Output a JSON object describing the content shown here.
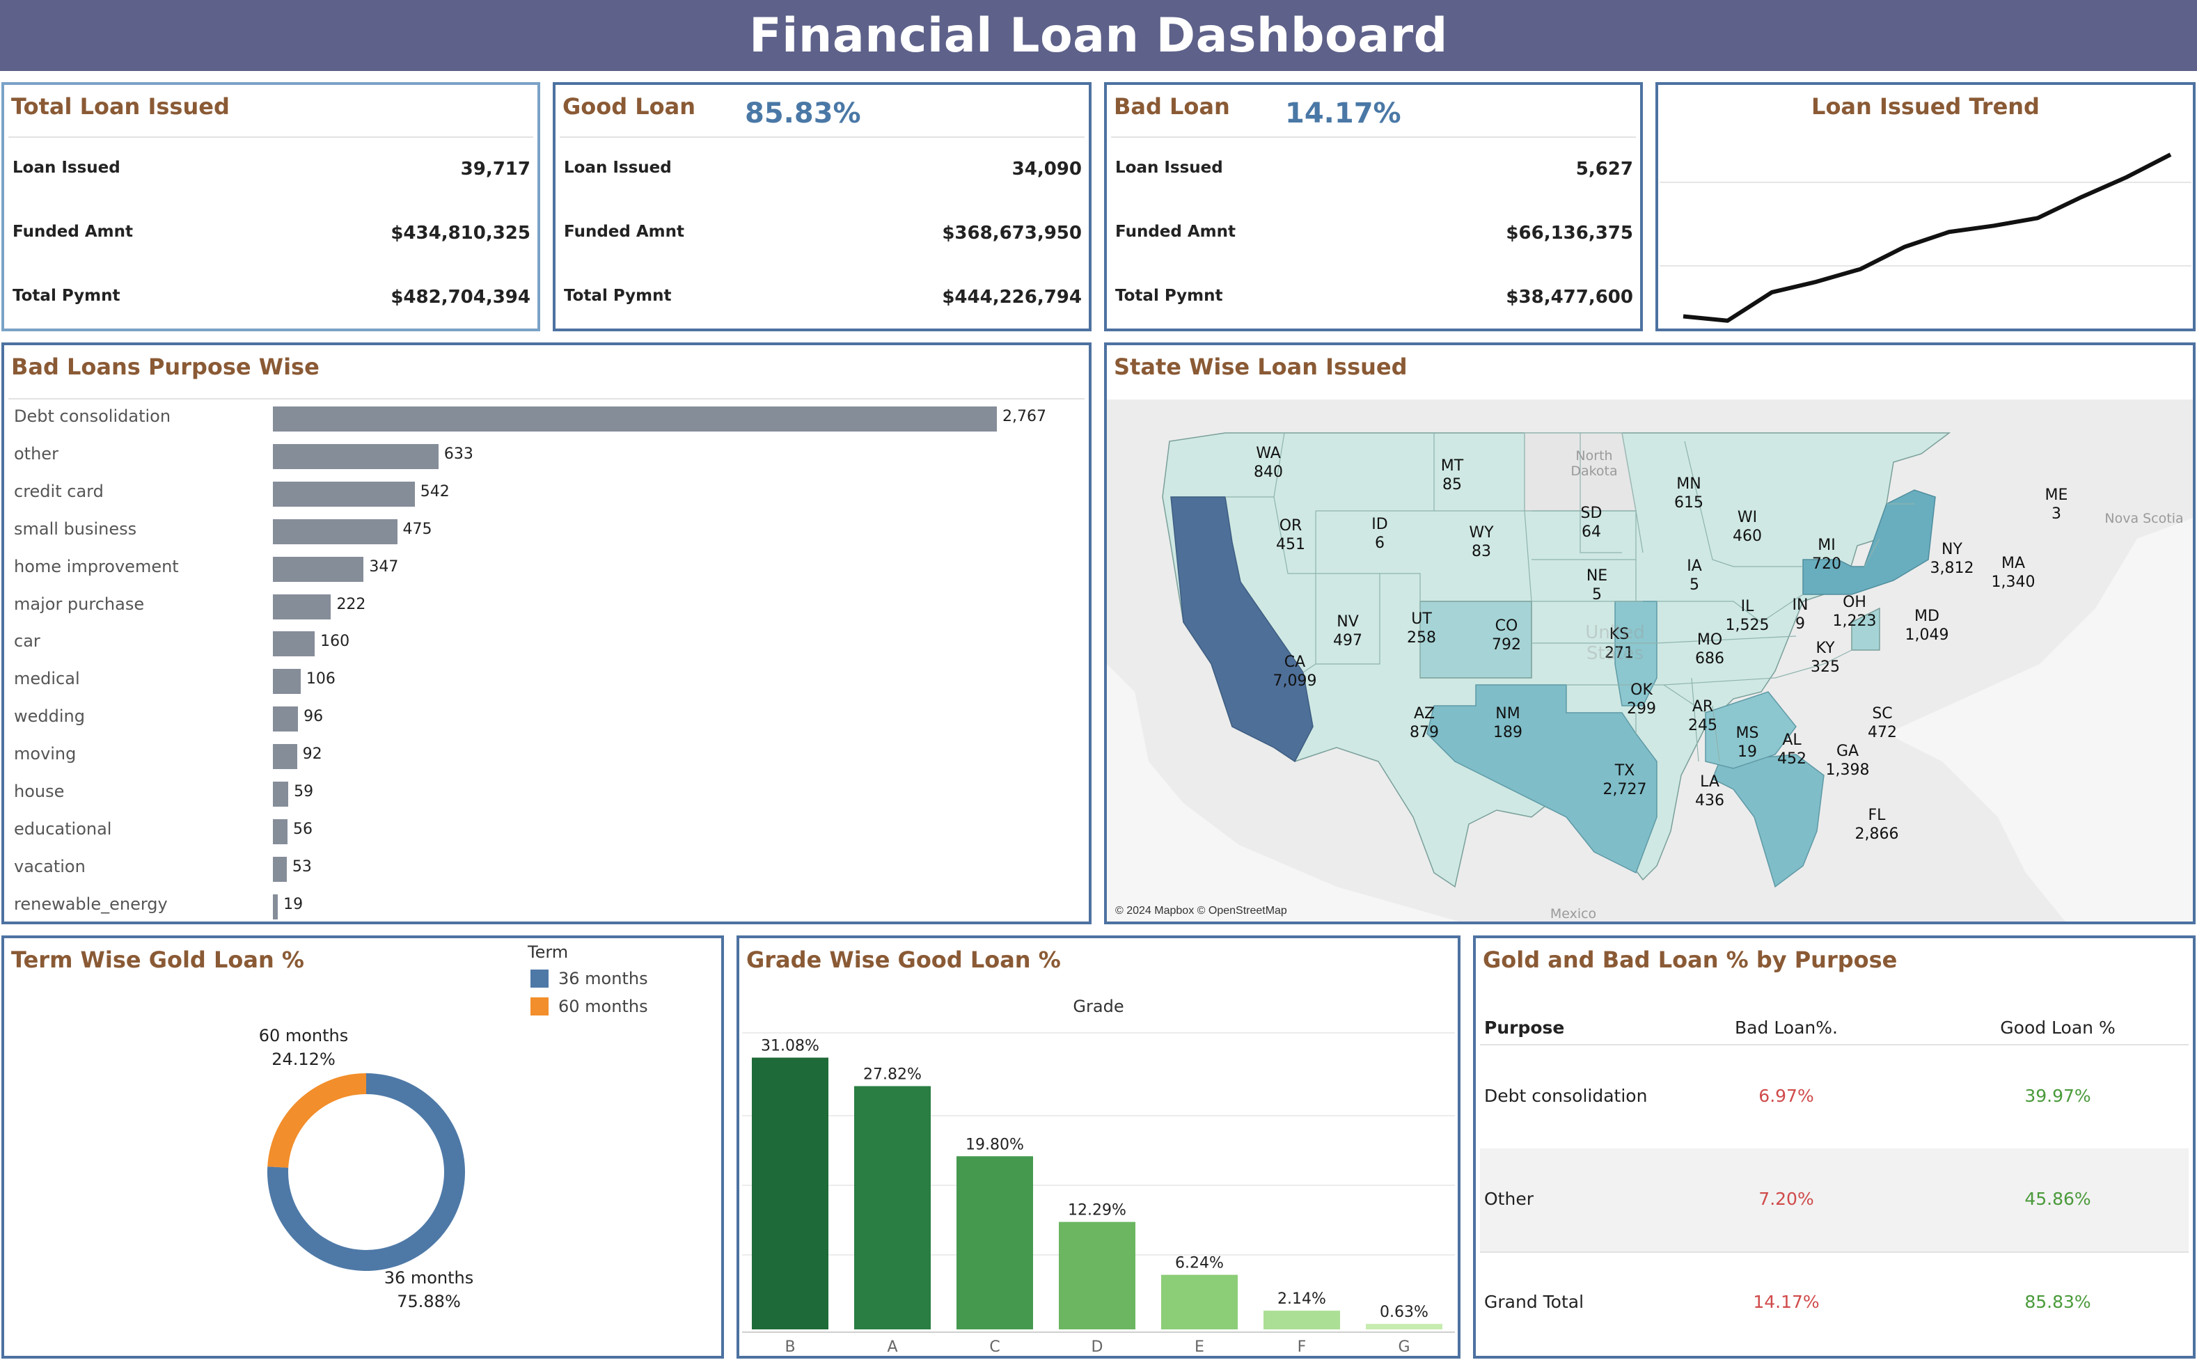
{
  "header": {
    "title": "Financial Loan Dashboard"
  },
  "kpi": {
    "total": {
      "title": "Total Loan Issued",
      "rows": [
        {
          "label": "Loan Issued",
          "value": "39,717"
        },
        {
          "label": "Funded Amnt",
          "value": "$434,810,325"
        },
        {
          "label": "Total Pymnt",
          "value": "$482,704,394"
        }
      ]
    },
    "good": {
      "title": "Good Loan",
      "pct": "85.83%",
      "rows": [
        {
          "label": "Loan Issued",
          "value": "34,090"
        },
        {
          "label": "Funded Amnt",
          "value": "$368,673,950"
        },
        {
          "label": "Total Pymnt",
          "value": "$444,226,794"
        }
      ]
    },
    "bad": {
      "title": "Bad Loan",
      "pct": "14.17%",
      "rows": [
        {
          "label": "Loan Issued",
          "value": "5,627"
        },
        {
          "label": "Funded Amnt",
          "value": "$66,136,375"
        },
        {
          "label": "Total Pymnt",
          "value": "$38,477,600"
        }
      ]
    }
  },
  "trend": {
    "title": "Loan Issued Trend"
  },
  "purpose": {
    "title": "Bad Loans Purpose Wise"
  },
  "map": {
    "title": "State Wise Loan Issued",
    "attribution": "© 2024 Mapbox © OpenStreetMap",
    "base_labels": [
      "North Dakota",
      "Nova Scotia",
      "Mexico",
      "United States"
    ],
    "states": [
      {
        "code": "WA",
        "value": "840"
      },
      {
        "code": "OR",
        "value": "451"
      },
      {
        "code": "CA",
        "value": "7,099"
      },
      {
        "code": "NV",
        "value": "497"
      },
      {
        "code": "ID",
        "value": "6"
      },
      {
        "code": "MT",
        "value": "85"
      },
      {
        "code": "WY",
        "value": "83"
      },
      {
        "code": "UT",
        "value": "258"
      },
      {
        "code": "AZ",
        "value": "879"
      },
      {
        "code": "CO",
        "value": "792"
      },
      {
        "code": "NM",
        "value": "189"
      },
      {
        "code": "SD",
        "value": "64"
      },
      {
        "code": "NE",
        "value": "5"
      },
      {
        "code": "KS",
        "value": "271"
      },
      {
        "code": "OK",
        "value": "299"
      },
      {
        "code": "TX",
        "value": "2,727"
      },
      {
        "code": "MN",
        "value": "615"
      },
      {
        "code": "IA",
        "value": "5"
      },
      {
        "code": "MO",
        "value": "686"
      },
      {
        "code": "AR",
        "value": "245"
      },
      {
        "code": "LA",
        "value": "436"
      },
      {
        "code": "WI",
        "value": "460"
      },
      {
        "code": "IL",
        "value": "1,525"
      },
      {
        "code": "MS",
        "value": "19"
      },
      {
        "code": "MI",
        "value": "720"
      },
      {
        "code": "IN",
        "value": "9"
      },
      {
        "code": "KY",
        "value": "325"
      },
      {
        "code": "AL",
        "value": "452"
      },
      {
        "code": "OH",
        "value": "1,223"
      },
      {
        "code": "GA",
        "value": "1,398"
      },
      {
        "code": "FL",
        "value": "2,866"
      },
      {
        "code": "SC",
        "value": "472"
      },
      {
        "code": "MD",
        "value": "1,049"
      },
      {
        "code": "NY",
        "value": "3,812"
      },
      {
        "code": "MA",
        "value": "1,340"
      },
      {
        "code": "ME",
        "value": "3"
      }
    ]
  },
  "term": {
    "title": "Term Wise Gold Loan %",
    "legend_title": "Term",
    "colors": {
      "36 months": "#4e79a7",
      "60 months": "#f28e2b"
    }
  },
  "grade": {
    "title": "Grade Wise Good Loan %",
    "axis_title": "Grade"
  },
  "table": {
    "title": "Gold and Bad Loan % by Purpose",
    "headers": [
      "Purpose",
      "Bad Loan%.",
      "Good Loan %"
    ],
    "rows": [
      {
        "purpose": "Debt consolidation",
        "bad": "6.97%",
        "good": "39.97%"
      },
      {
        "purpose": "Other",
        "bad": "7.20%",
        "good": "45.86%"
      },
      {
        "purpose": "Grand Total",
        "bad": "14.17%",
        "good": "85.83%"
      }
    ]
  },
  "chart_data": [
    {
      "type": "line",
      "title": "Loan Issued Trend",
      "x": [
        "1",
        "2",
        "3",
        "4",
        "5",
        "6",
        "7",
        "8",
        "9",
        "10",
        "11",
        "12"
      ],
      "series": [
        {
          "values": [
            2332,
            2279,
            2627,
            2755,
            2911,
            3184,
            3366,
            3441,
            3536,
            3796,
            4035,
            4314
          ]
        }
      ],
      "grid": true
    },
    {
      "type": "bar",
      "orientation": "horizontal",
      "title": "Bad Loans Purpose Wise",
      "categories": [
        "Debt consolidation",
        "other",
        "credit card",
        "small business",
        "home improvement",
        "major purchase",
        "car",
        "medical",
        "wedding",
        "moving",
        "house",
        "educational",
        "vacation",
        "renewable_energy"
      ],
      "values": [
        2767,
        633,
        542,
        475,
        347,
        222,
        160,
        106,
        96,
        92,
        59,
        56,
        53,
        19
      ],
      "labels": [
        "2,767",
        "633",
        "542",
        "475",
        "347",
        "222",
        "160",
        "106",
        "96",
        "92",
        "59",
        "56",
        "53",
        "19"
      ]
    },
    {
      "type": "pie",
      "title": "Term Wise Gold Loan %",
      "categories": [
        "36 months",
        "60 months"
      ],
      "values": [
        75.88,
        24.12
      ],
      "labels": [
        "75.88%",
        "24.12%"
      ]
    },
    {
      "type": "bar",
      "title": "Grade Wise Good Loan %",
      "xlabel": "Grade",
      "categories": [
        "B",
        "A",
        "C",
        "D",
        "E",
        "F",
        "G"
      ],
      "values": [
        31.08,
        27.82,
        19.8,
        12.29,
        6.24,
        2.14,
        0.63
      ],
      "labels": [
        "31.08%",
        "27.82%",
        "19.80%",
        "12.29%",
        "6.24%",
        "2.14%",
        "0.63%"
      ],
      "colors": [
        "#1e6a39",
        "#2a7d43",
        "#45994f",
        "#6cb662",
        "#8ccd78",
        "#acdf96",
        "#c7ecb0"
      ],
      "ylim": [
        0,
        32
      ]
    }
  ]
}
